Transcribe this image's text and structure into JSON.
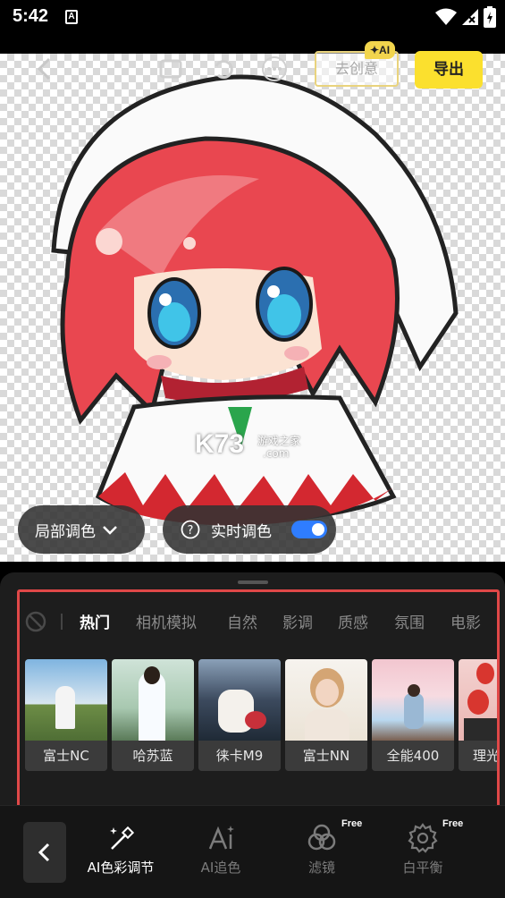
{
  "status_bar": {
    "time": "5:42",
    "notification_letter": "A"
  },
  "toolbar": {
    "ai_button_label": "去创意",
    "ai_badge": "✦AI",
    "export_label": "导出"
  },
  "canvas": {
    "watermark_main": "K73",
    "watermark_sub": "游戏之家",
    "watermark_domain": ".com"
  },
  "controls": {
    "local_color_label": "局部调色",
    "realtime_color_label": "实时调色",
    "realtime_enabled": true
  },
  "panel": {
    "tabs": [
      {
        "label": "热门",
        "active": true
      },
      {
        "label": "相机模拟",
        "active": false
      },
      {
        "label": "自然",
        "active": false
      },
      {
        "label": "影调",
        "active": false
      },
      {
        "label": "质感",
        "active": false
      },
      {
        "label": "氛围",
        "active": false
      },
      {
        "label": "电影",
        "active": false
      }
    ],
    "filters": [
      {
        "label": "富士NC",
        "colors": [
          "#7fb4e0",
          "#d9e6f0",
          "#6d8d46"
        ]
      },
      {
        "label": "哈苏蓝",
        "colors": [
          "#cfe3d8",
          "#ffffff",
          "#5a7a58"
        ]
      },
      {
        "label": "徕卡M9",
        "colors": [
          "#3c4a5e",
          "#1f2a36",
          "#c8303a"
        ]
      },
      {
        "label": "富士NN",
        "colors": [
          "#f3efe7",
          "#e8c9b0",
          "#b9a58c"
        ]
      },
      {
        "label": "全能400",
        "colors": [
          "#f2c6cf",
          "#b9d8ef",
          "#7a6050"
        ]
      },
      {
        "label": "理光正片",
        "colors": [
          "#d8362f",
          "#f3d2d0",
          "#2a2a2a"
        ]
      }
    ]
  },
  "bottom_nav": {
    "items": [
      {
        "label": "AI色彩调节",
        "active": true,
        "free": false
      },
      {
        "label": "AI追色",
        "active": false,
        "free": false
      },
      {
        "label": "滤镜",
        "active": false,
        "free": true
      },
      {
        "label": "白平衡",
        "active": false,
        "free": true
      }
    ],
    "free_tag": "Free"
  }
}
